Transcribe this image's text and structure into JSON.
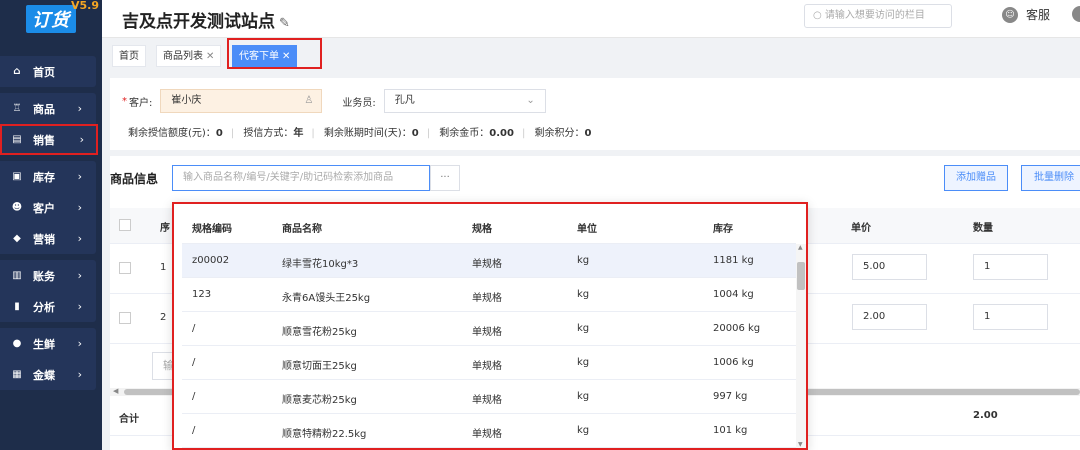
{
  "app": {
    "logo": "订货",
    "version": "V5.9"
  },
  "sidebar": {
    "items": [
      {
        "label": "首页",
        "icon": "home-icon",
        "glyph": "⌂",
        "chevron": ""
      },
      {
        "label": "商品",
        "icon": "cart-icon",
        "glyph": "♖",
        "chevron": "›"
      },
      {
        "label": "销售",
        "icon": "document-icon",
        "glyph": "▤",
        "chevron": "›"
      },
      {
        "label": "库存",
        "icon": "warehouse-icon",
        "glyph": "▣",
        "chevron": "›"
      },
      {
        "label": "客户",
        "icon": "users-icon",
        "glyph": "☻",
        "chevron": "›"
      },
      {
        "label": "营销",
        "icon": "tag-icon",
        "glyph": "◆",
        "chevron": "›"
      },
      {
        "label": "账务",
        "icon": "wallet-icon",
        "glyph": "▥",
        "chevron": "›"
      },
      {
        "label": "分析",
        "icon": "bar-chart-icon",
        "glyph": "▮",
        "chevron": "›"
      },
      {
        "label": "生鲜",
        "icon": "leaf-icon",
        "glyph": "●",
        "chevron": "›"
      },
      {
        "label": "金蝶",
        "icon": "butterfly-icon",
        "glyph": "▦",
        "chevron": "›"
      }
    ]
  },
  "header": {
    "title": "吉及点开发测试站点",
    "edit_glyph": "✎",
    "search_placeholder": "请输入想要访问的栏目",
    "search_glyph": "○",
    "service_label": "客服",
    "service_glyph": "☺"
  },
  "tabs": [
    {
      "label": "首页",
      "close": ""
    },
    {
      "label": "商品列表",
      "close": "✕"
    },
    {
      "label": "代客下单",
      "close": "✕"
    }
  ],
  "customer": {
    "customer_label": "客户:",
    "customer_value": "崔小庆",
    "user_glyph": "♙",
    "salesperson_label": "业务员:",
    "salesperson_value": "孔凡",
    "select_glyph": "⌄",
    "stats": [
      {
        "label": "剩余授信额度(元)：",
        "value": "0"
      },
      {
        "label": "授信方式：",
        "value": "年"
      },
      {
        "label": "剩余账期时间(天)：",
        "value": "0"
      },
      {
        "label": "剩余金币：",
        "value": "0.00"
      },
      {
        "label": "剩余积分：",
        "value": "0"
      }
    ]
  },
  "goods": {
    "section_title": "商品信息",
    "search_placeholder": "输入商品名称/编号/关键字/助记码检索添加商品",
    "more_glyph": "···",
    "add_gift_button": "添加赠品",
    "batch_delete_button": "批量删除",
    "columns": {
      "seq": "序",
      "unit_price": "单价",
      "quantity": "数量"
    },
    "rows": [
      {
        "seq": "1",
        "unit_price": "5.00",
        "quantity": "1"
      },
      {
        "seq": "2",
        "unit_price": "2.00",
        "quantity": "1"
      }
    ],
    "add_row_placeholder": "输",
    "total_label": "合计",
    "total_quantity": "2.00"
  },
  "dropdown": {
    "columns": [
      "规格编码",
      "商品名称",
      "规格",
      "单位",
      "库存"
    ],
    "rows": [
      [
        "z00002",
        "绿丰雪花10kg*3",
        "单规格",
        "kg",
        "1181 kg"
      ],
      [
        "123",
        "永青6A馒头王25kg",
        "单规格",
        "kg",
        "1004 kg"
      ],
      [
        "/",
        "顺意雪花粉25kg",
        "单规格",
        "kg",
        "20006 kg"
      ],
      [
        "/",
        "顺意切面王25kg",
        "单规格",
        "kg",
        "1006 kg"
      ],
      [
        "/",
        "顺意麦芯粉25kg",
        "单规格",
        "kg",
        "997 kg"
      ],
      [
        "/",
        "顺意特精粉22.5kg",
        "单规格",
        "kg",
        "101 kg"
      ]
    ]
  },
  "colors": {
    "primary": "#4b8df8",
    "sidebar": "#1e2d4a",
    "highlight": "#e02020"
  }
}
